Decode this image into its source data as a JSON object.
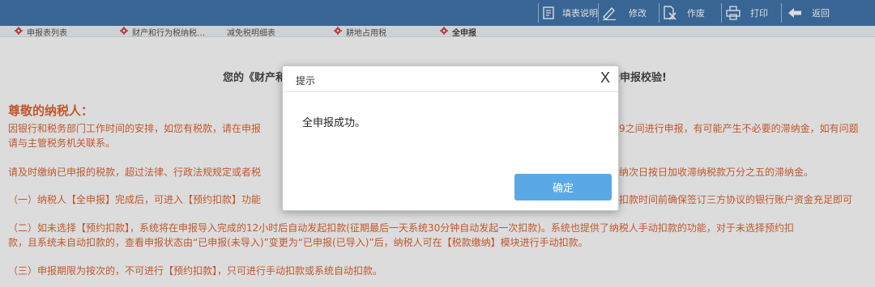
{
  "toolbar": {
    "items": [
      {
        "label": "填表说明",
        "icon": "form-guide-icon"
      },
      {
        "label": "修改",
        "icon": "pencil-icon"
      },
      {
        "label": "作废",
        "icon": "void-document-icon"
      },
      {
        "label": "打印",
        "icon": "printer-icon"
      },
      {
        "label": "返回",
        "icon": "back-arrow-icon"
      }
    ]
  },
  "tabs": [
    {
      "label": "申报表列表",
      "icon": "gear-icon"
    },
    {
      "label": "财产和行为税纳税…",
      "icon": "gear-icon"
    },
    {
      "label": "减免税明细表"
    },
    {
      "label": "耕地占用税",
      "icon": "gear-icon"
    },
    {
      "label": "全申报",
      "icon": "gear-icon",
      "active": true
    }
  ],
  "content": {
    "banner_left": "您的《财产和",
    "banner_right": "全申报校验!",
    "greeting": "尊敬的纳税人：",
    "paragraphs": [
      {
        "line1_left": "因银行和税务部门工作时间的安排，如您有税款，请在申报",
        "line1_right": "9之间进行申报，有可能产生不必要的滞纳金，如有问题",
        "line2": "请与主管税务机关联系。"
      },
      {
        "line1_left": "请及时缴纳已申报的税款，超过法律、行政法规规定或者税",
        "line1_right": "纳次日按日加收滞纳税款万分之五的滞纳金。"
      },
      {
        "line1_left": "（一）纳税人【全申报】完成后，可进入【预约扣款】功能",
        "line1_right": "扣款时间前确保签订三方协议的银行账户资金充足即可"
      },
      {
        "line1": "（二）如未选择【预约扣款】，系统将在申报导入完成的12小时后自动发起扣款(征期最后一天系统30分钟自动发起一次扣款)。系统也提供了纳税人手动扣款的功能，对于未选择预约扣",
        "line2": "款，且系统未自动扣款的，查看申报状态由“已申报(未导入)”变更为“已申报(已导入)”后，纳税人可在【税款缴纳】模块进行手动扣款。"
      },
      {
        "line1": "（三）申报期限为按次的，不可进行【预约扣款】，只可进行手动扣款或系统自动扣款。"
      }
    ]
  },
  "dialog": {
    "title": "提示",
    "close_label": "X",
    "message": "全申报成功。",
    "ok_label": "确定"
  },
  "colors": {
    "toolbar_bg": "#1c5a9c",
    "notice_text": "#d9480f",
    "gear": "#cc2222",
    "ok_button": "#5aa9e6"
  }
}
